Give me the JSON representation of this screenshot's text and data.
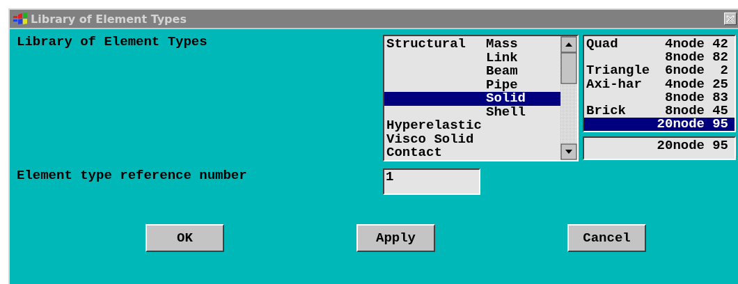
{
  "window": {
    "title": "Library of Element Types"
  },
  "heading": "Library of Element Types",
  "category_list": {
    "rows": [
      {
        "group": "Structural",
        "item": "Mass",
        "selected": false
      },
      {
        "item": "Link",
        "selected": false
      },
      {
        "item": "Beam",
        "selected": false
      },
      {
        "item": "Pipe",
        "selected": false
      },
      {
        "item": "Solid",
        "selected": true
      },
      {
        "item": "Shell",
        "selected": false
      },
      {
        "group": "Hyperelastic",
        "selected": false
      },
      {
        "group": "Visco Solid",
        "selected": false
      },
      {
        "group": "Contact",
        "selected": false
      }
    ]
  },
  "type_list": {
    "rows": [
      {
        "shape": "Quad",
        "nodes": "4node",
        "number": "42",
        "selected": false
      },
      {
        "nodes": "8node",
        "number": "82",
        "selected": false
      },
      {
        "shape": "Triangle",
        "nodes": "6node",
        "number": "2",
        "selected": false
      },
      {
        "shape": "Axi-har",
        "nodes": "4node",
        "number": "25",
        "selected": false
      },
      {
        "nodes": "8node",
        "number": "83",
        "selected": false
      },
      {
        "shape": "Brick",
        "nodes": "8node",
        "number": "45",
        "selected": false
      },
      {
        "nodes": "20node",
        "number": "95",
        "selected": true
      }
    ]
  },
  "selection_field": {
    "nodes": "20node",
    "number": "95"
  },
  "reference": {
    "label": "Element type reference number",
    "value": "1"
  },
  "buttons": [
    "OK",
    "Apply",
    "Cancel"
  ]
}
